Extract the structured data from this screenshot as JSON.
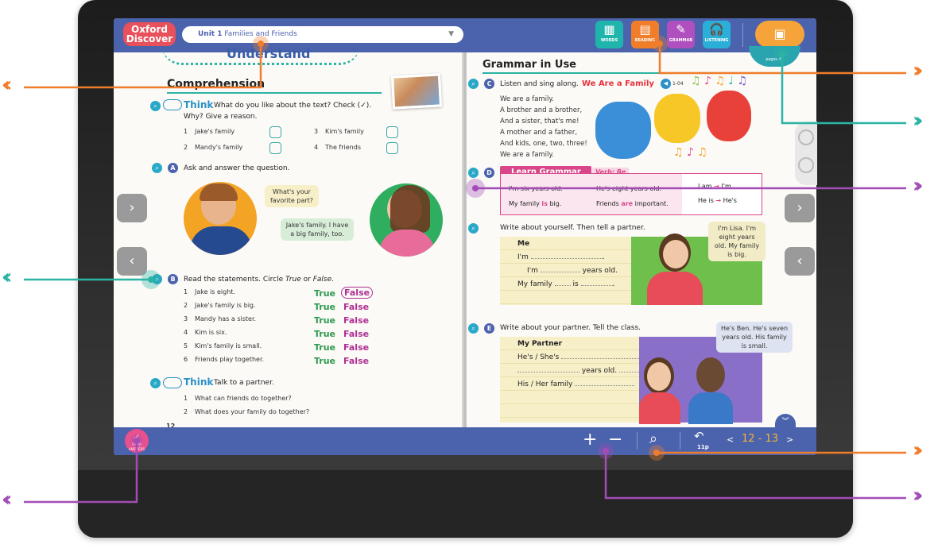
{
  "topbar": {
    "logo": "Oxford Discover",
    "unit_label": "Unit 1",
    "unit_title": "Families and Friends",
    "caret": "▼",
    "tools": [
      {
        "label": "WORDS",
        "icon": "▦"
      },
      {
        "label": "READING",
        "icon": "▤"
      },
      {
        "label": "GRAMMAR",
        "icon": "✎"
      },
      {
        "label": "LISTENING",
        "icon": "🎧"
      }
    ],
    "cover_icon": "▣",
    "pages_note": "pages 6–"
  },
  "left": {
    "banner": "Understand",
    "heading": "Comprehension",
    "think1": {
      "word": "Think",
      "prompt": "What do you like about the text? Check (✓).",
      "prompt2": "Why? Give a reason."
    },
    "choices": [
      {
        "n": "1",
        "t": "Jake's family"
      },
      {
        "n": "2",
        "t": "Mandy's family"
      },
      {
        "n": "3",
        "t": "Kim's family"
      },
      {
        "n": "4",
        "t": "The friends"
      }
    ],
    "a": {
      "letter": "A",
      "text": "Ask and answer the question."
    },
    "bubble1": "What's your favorite part?",
    "bubble2": "Jake's family. I have a big family, too.",
    "b": {
      "letter": "B",
      "text_pre": "Read the statements. Circle ",
      "true_word": "True",
      "mid": " or ",
      "false_word": "False",
      "end": "."
    },
    "statements": [
      {
        "n": "1",
        "t": "Jake is eight.",
        "tv": "True",
        "fv": "False"
      },
      {
        "n": "2",
        "t": "Jake's family is big.",
        "tv": "True",
        "fv": "False"
      },
      {
        "n": "3",
        "t": "Mandy has a sister.",
        "tv": "True",
        "fv": "False"
      },
      {
        "n": "4",
        "t": "Kim is six.",
        "tv": "True",
        "fv": "False"
      },
      {
        "n": "5",
        "t": "Kim's family is small.",
        "tv": "True",
        "fv": "False"
      },
      {
        "n": "6",
        "t": "Friends play together.",
        "tv": "True",
        "fv": "False"
      }
    ],
    "think2": {
      "word": "Think",
      "prompt": "Talk to a partner."
    },
    "talk": [
      {
        "n": "1",
        "t": "What can friends do together?"
      },
      {
        "n": "2",
        "t": "What does your family do together?"
      }
    ],
    "page_no": "12"
  },
  "right": {
    "heading": "Grammar in Use",
    "c": {
      "letter": "C",
      "text": "Listen and sing along.",
      "song": "We Are a Family",
      "track": "1-04"
    },
    "song_lines": [
      "We are a family.",
      "A brother and a brother,",
      "And a sister, that's me!",
      "A mother and a father,",
      "And kids, one, two, three!",
      "We are a family."
    ],
    "d": {
      "letter": "D",
      "title": "Learn Grammar",
      "verb": "Verb: Be"
    },
    "grammar": {
      "r1a": "I'm six years old.",
      "r1b": "He's eight years old.",
      "r2a_pre": "My family ",
      "r2a_is": "is",
      "r2a_post": " big.",
      "r2b_pre": "Friends ",
      "r2b_are": "are",
      "r2b_post": " important.",
      "c1a": "I am",
      "c1arrow": "→",
      "c1b": "I'm",
      "c2a": "He is",
      "c2arrow": "→",
      "c2b": "He's"
    },
    "e1": {
      "text": "Write about yourself. Then tell a partner."
    },
    "me": {
      "title": "Me",
      "l1": "I'm",
      "l2a": "I'm",
      "l2b": "years old.",
      "l3a": "My family",
      "l3b": "is",
      "dot": "."
    },
    "bubble_lisa": "I'm Lisa. I'm eight years old. My family is big.",
    "e2": {
      "letter": "E",
      "text": "Write about your partner. Tell the class."
    },
    "partner": {
      "title": "My Partner",
      "l1": "He's / She's",
      "l2": "years old.",
      "l3": "His / Her family"
    },
    "bubble_ben": "He's Ben. He's seven years old. His family is small."
  },
  "bottombar": {
    "show_label": "SHOW ANSWERS",
    "plus": "+",
    "minus": "−",
    "back_page": "11p",
    "prev": "<",
    "page_a": "12",
    "sep": "-",
    "page_b": "13",
    "next": ">"
  },
  "colors": {
    "bar": "#4b62ac",
    "orange": "#f07d2a",
    "teal": "#2bb3a3",
    "purple": "#a24db6"
  }
}
